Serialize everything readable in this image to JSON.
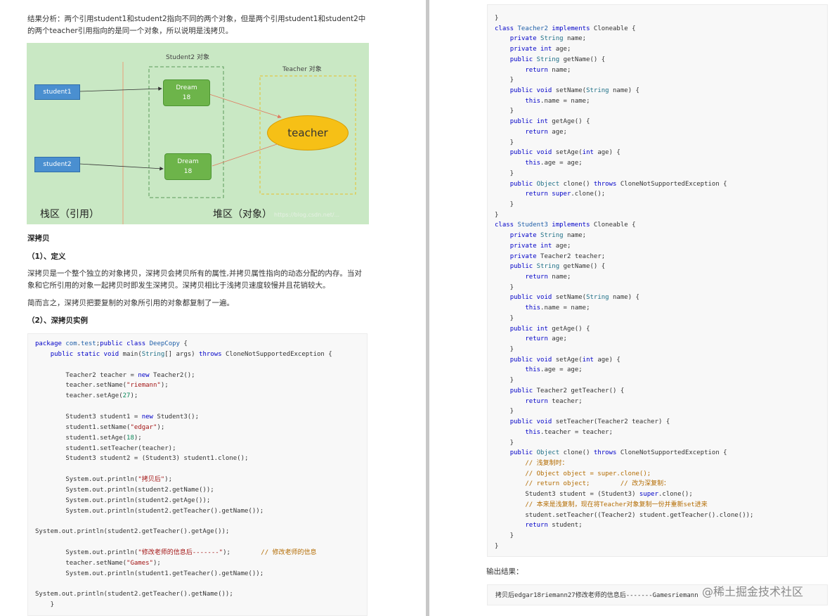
{
  "left": {
    "analysis": "结果分析：两个引用student1和student2指向不同的两个对象，但是两个引用student1和student2中的两个teacher引用指向的是同一个对象，所以说明是浅拷贝。",
    "diagram": {
      "student2_obj_label": "Student2 对象",
      "teacher_obj_label": "Teacher 对象",
      "ref1": "student1",
      "ref2": "student2",
      "obj1_name": "Dream",
      "obj1_age": "18",
      "obj2_name": "Dream",
      "obj2_age": "18",
      "teacher": "teacher",
      "stack_label": "栈区（引用）",
      "heap_label": "堆区（对象）",
      "img_watermark": "https://blog.csdn.net/..."
    },
    "deep_copy_heading": "深拷贝",
    "def_heading": "（1）、定义",
    "def_text": "深拷贝是一个整个独立的对象拷贝，深拷贝会拷贝所有的属性,并拷贝属性指向的动态分配的内存。当对象和它所引用的对象一起拷贝时即发生深拷贝。深拷贝相比于浅拷贝速度较慢并且花销较大。",
    "summary": "简而言之，深拷贝把要复制的对象所引用的对象都复制了一遍。",
    "example_heading": "（2）、深拷贝实例",
    "code_lines": [
      [
        [
          "kw",
          "package "
        ],
        [
          "cls",
          "com"
        ],
        [
          "",
          "."
        ],
        [
          "cls",
          "test"
        ],
        [
          "",
          ";"
        ],
        [
          "kw",
          "public class "
        ],
        [
          "cls",
          "DeepCopy"
        ],
        [
          "",
          " {"
        ]
      ],
      [
        [
          "",
          "    "
        ],
        [
          "kw",
          "public static void "
        ],
        [
          "",
          "main("
        ],
        [
          "ty",
          "String"
        ],
        [
          "",
          "[] args) "
        ],
        [
          "kw",
          "throws "
        ],
        [
          "",
          "CloneNotSupportedException {"
        ]
      ],
      [],
      [
        [
          "",
          "        Teacher2 teacher = "
        ],
        [
          "kw",
          "new "
        ],
        [
          "",
          "Teacher2();"
        ]
      ],
      [
        [
          "",
          "        teacher.setName("
        ],
        [
          "st",
          "\"riemann\""
        ],
        [
          "",
          ");"
        ]
      ],
      [
        [
          "",
          "        teacher.setAge("
        ],
        [
          "nm",
          "27"
        ],
        [
          "",
          ");"
        ]
      ],
      [],
      [
        [
          "",
          "        Student3 student1 = "
        ],
        [
          "kw",
          "new "
        ],
        [
          "",
          "Student3();"
        ]
      ],
      [
        [
          "",
          "        student1.setName("
        ],
        [
          "st",
          "\"edgar\""
        ],
        [
          "",
          ");"
        ]
      ],
      [
        [
          "",
          "        student1.setAge("
        ],
        [
          "nm",
          "18"
        ],
        [
          "",
          ");"
        ]
      ],
      [
        [
          "",
          "        student1.setTeacher(teacher);"
        ]
      ],
      [
        [
          "",
          "        Student3 student2 = (Student3) student1.clone();"
        ]
      ],
      [],
      [
        [
          "",
          "        System.out.println("
        ],
        [
          "st",
          "\"拷贝后\""
        ],
        [
          "",
          ");"
        ]
      ],
      [
        [
          "",
          "        System.out.println(student2.getName());"
        ]
      ],
      [
        [
          "",
          "        System.out.println(student2.getAge());"
        ]
      ],
      [
        [
          "",
          "        System.out.println(student2.getTeacher().getName());"
        ]
      ],
      [],
      [
        [
          "",
          "System.out.println(student2.getTeacher().getAge());"
        ]
      ],
      [],
      [
        [
          "",
          "        System.out.println("
        ],
        [
          "st",
          "\"修改老师的信息后-------\""
        ],
        [
          "",
          ");        "
        ],
        [
          "cm",
          "// 修改老师的信息"
        ]
      ],
      [
        [
          "",
          "        teacher.setName("
        ],
        [
          "st",
          "\"Games\""
        ],
        [
          "",
          ");"
        ]
      ],
      [
        [
          "",
          "        System.out.println(student1.getTeacher().getName());"
        ]
      ],
      [],
      [
        [
          "",
          "System.out.println(student2.getTeacher().getName());"
        ]
      ],
      [
        [
          "",
          "    }"
        ]
      ]
    ]
  },
  "right": {
    "code_lines": [
      [
        [
          "",
          "}"
        ]
      ],
      [
        [
          "kw",
          "class "
        ],
        [
          "cls",
          "Teacher2 "
        ],
        [
          "kw",
          "implements "
        ],
        [
          "",
          "Cloneable {"
        ]
      ],
      [
        [
          "",
          "    "
        ],
        [
          "kw",
          "private "
        ],
        [
          "ty",
          "String "
        ],
        [
          "",
          "name;"
        ]
      ],
      [
        [
          "",
          "    "
        ],
        [
          "kw",
          "private int "
        ],
        [
          "",
          "age;"
        ]
      ],
      [
        [
          "",
          "    "
        ],
        [
          "kw",
          "public "
        ],
        [
          "ty",
          "String "
        ],
        [
          "",
          "getName() {"
        ]
      ],
      [
        [
          "",
          "        "
        ],
        [
          "kw",
          "return "
        ],
        [
          "",
          "name;"
        ]
      ],
      [
        [
          "",
          "    }"
        ]
      ],
      [
        [
          "",
          "    "
        ],
        [
          "kw",
          "public void "
        ],
        [
          "",
          "setName("
        ],
        [
          "ty",
          "String "
        ],
        [
          "",
          "name) {"
        ]
      ],
      [
        [
          "",
          "        "
        ],
        [
          "kw",
          "this"
        ],
        [
          "",
          ".name = name;"
        ]
      ],
      [
        [
          "",
          "    }"
        ]
      ],
      [
        [
          "",
          "    "
        ],
        [
          "kw",
          "public int "
        ],
        [
          "",
          "getAge() {"
        ]
      ],
      [
        [
          "",
          "        "
        ],
        [
          "kw",
          "return "
        ],
        [
          "",
          "age;"
        ]
      ],
      [
        [
          "",
          "    }"
        ]
      ],
      [
        [
          "",
          "    "
        ],
        [
          "kw",
          "public void "
        ],
        [
          "",
          "setAge("
        ],
        [
          "kw",
          "int "
        ],
        [
          "",
          "age) {"
        ]
      ],
      [
        [
          "",
          "        "
        ],
        [
          "kw",
          "this"
        ],
        [
          "",
          ".age = age;"
        ]
      ],
      [
        [
          "",
          "    }"
        ]
      ],
      [
        [
          "",
          "    "
        ],
        [
          "kw",
          "public "
        ],
        [
          "ty",
          "Object "
        ],
        [
          "",
          "clone() "
        ],
        [
          "kw",
          "throws "
        ],
        [
          "",
          "CloneNotSupportedException {"
        ]
      ],
      [
        [
          "",
          "        "
        ],
        [
          "kw",
          "return super"
        ],
        [
          "",
          ".clone();"
        ]
      ],
      [
        [
          "",
          "    }"
        ]
      ],
      [
        [
          "",
          "}"
        ]
      ],
      [
        [
          "kw",
          "class "
        ],
        [
          "cls",
          "Student3 "
        ],
        [
          "kw",
          "implements "
        ],
        [
          "",
          "Cloneable {"
        ]
      ],
      [
        [
          "",
          "    "
        ],
        [
          "kw",
          "private "
        ],
        [
          "ty",
          "String "
        ],
        [
          "",
          "name;"
        ]
      ],
      [
        [
          "",
          "    "
        ],
        [
          "kw",
          "private int "
        ],
        [
          "",
          "age;"
        ]
      ],
      [
        [
          "",
          "    "
        ],
        [
          "kw",
          "private "
        ],
        [
          "",
          "Teacher2 teacher;"
        ]
      ],
      [
        [
          "",
          "    "
        ],
        [
          "kw",
          "public "
        ],
        [
          "ty",
          "String "
        ],
        [
          "",
          "getName() {"
        ]
      ],
      [
        [
          "",
          "        "
        ],
        [
          "kw",
          "return "
        ],
        [
          "",
          "name;"
        ]
      ],
      [
        [
          "",
          "    }"
        ]
      ],
      [
        [
          "",
          "    "
        ],
        [
          "kw",
          "public void "
        ],
        [
          "",
          "setName("
        ],
        [
          "ty",
          "String "
        ],
        [
          "",
          "name) {"
        ]
      ],
      [
        [
          "",
          "        "
        ],
        [
          "kw",
          "this"
        ],
        [
          "",
          ".name = name;"
        ]
      ],
      [
        [
          "",
          "    }"
        ]
      ],
      [
        [
          "",
          "    "
        ],
        [
          "kw",
          "public int "
        ],
        [
          "",
          "getAge() {"
        ]
      ],
      [
        [
          "",
          "        "
        ],
        [
          "kw",
          "return "
        ],
        [
          "",
          "age;"
        ]
      ],
      [
        [
          "",
          "    }"
        ]
      ],
      [
        [
          "",
          "    "
        ],
        [
          "kw",
          "public void "
        ],
        [
          "",
          "setAge("
        ],
        [
          "kw",
          "int "
        ],
        [
          "",
          "age) {"
        ]
      ],
      [
        [
          "",
          "        "
        ],
        [
          "kw",
          "this"
        ],
        [
          "",
          ".age = age;"
        ]
      ],
      [
        [
          "",
          "    }"
        ]
      ],
      [
        [
          "",
          "    "
        ],
        [
          "kw",
          "public "
        ],
        [
          "",
          "Teacher2 getTeacher() {"
        ]
      ],
      [
        [
          "",
          "        "
        ],
        [
          "kw",
          "return "
        ],
        [
          "",
          "teacher;"
        ]
      ],
      [
        [
          "",
          "    }"
        ]
      ],
      [
        [
          "",
          "    "
        ],
        [
          "kw",
          "public void "
        ],
        [
          "",
          "setTeacher(Teacher2 teacher) {"
        ]
      ],
      [
        [
          "",
          "        "
        ],
        [
          "kw",
          "this"
        ],
        [
          "",
          ".teacher = teacher;"
        ]
      ],
      [
        [
          "",
          "    }"
        ]
      ],
      [
        [
          "",
          "    "
        ],
        [
          "kw",
          "public "
        ],
        [
          "ty",
          "Object "
        ],
        [
          "",
          "clone() "
        ],
        [
          "kw",
          "throws "
        ],
        [
          "",
          "CloneNotSupportedException {"
        ]
      ],
      [
        [
          "",
          "        "
        ],
        [
          "cm",
          "// 浅复制时："
        ]
      ],
      [
        [
          "",
          "        "
        ],
        [
          "cm",
          "// Object object = super.clone();"
        ]
      ],
      [
        [
          "",
          "        "
        ],
        [
          "cm",
          "// return object;        // 改为深复制："
        ]
      ],
      [
        [
          "",
          "        Student3 student = (Student3) "
        ],
        [
          "kw",
          "super"
        ],
        [
          "",
          ".clone();"
        ]
      ],
      [
        [
          "",
          "        "
        ],
        [
          "cm",
          "// 本来是浅复制，现在将Teacher对象复制一份并重新set进来"
        ]
      ],
      [
        [
          "",
          "        student.setTeacher((Teacher2) student.getTeacher().clone());"
        ]
      ],
      [
        [
          "",
          "        "
        ],
        [
          "kw",
          "return "
        ],
        [
          "",
          "student;"
        ]
      ],
      [
        [
          "",
          "    }"
        ]
      ],
      [
        [
          "",
          "}"
        ]
      ]
    ],
    "output_label": "输出结果：",
    "output_text": "拷贝后edgar18riemann27修改老师的信息后-------Gamesriemann",
    "watermark": "@稀土掘金技术社区"
  }
}
